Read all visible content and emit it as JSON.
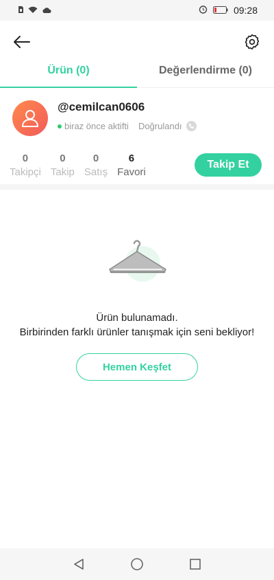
{
  "status_bar": {
    "time": "09:28",
    "icons": [
      "sim-icon",
      "wifi-icon",
      "cloud-icon",
      "alarm-icon",
      "battery-icon"
    ]
  },
  "header": {
    "back_icon": "arrow-left-icon",
    "settings_icon": "gear-icon"
  },
  "tabs": [
    {
      "label": "Ürün (0)",
      "active": true
    },
    {
      "label": "Değerlendirme (0)",
      "active": false
    }
  ],
  "profile": {
    "username": "@cemilcan0606",
    "status": "biraz önce aktifti",
    "verified_label": "Doğrulandı"
  },
  "stats": [
    {
      "value": "0",
      "label": "Takipçi"
    },
    {
      "value": "0",
      "label": "Takip"
    },
    {
      "value": "0",
      "label": "Satış"
    },
    {
      "value": "6",
      "label": "Favori"
    }
  ],
  "follow_button": "Takip Et",
  "empty_state": {
    "title": "Ürün bulunamadı.",
    "subtitle": "Birbirinden farklı ürünler tanışmak için seni bekliyor!",
    "button": "Hemen Keşfet"
  },
  "colors": {
    "accent": "#33d1a0",
    "online": "#2ecc71"
  }
}
